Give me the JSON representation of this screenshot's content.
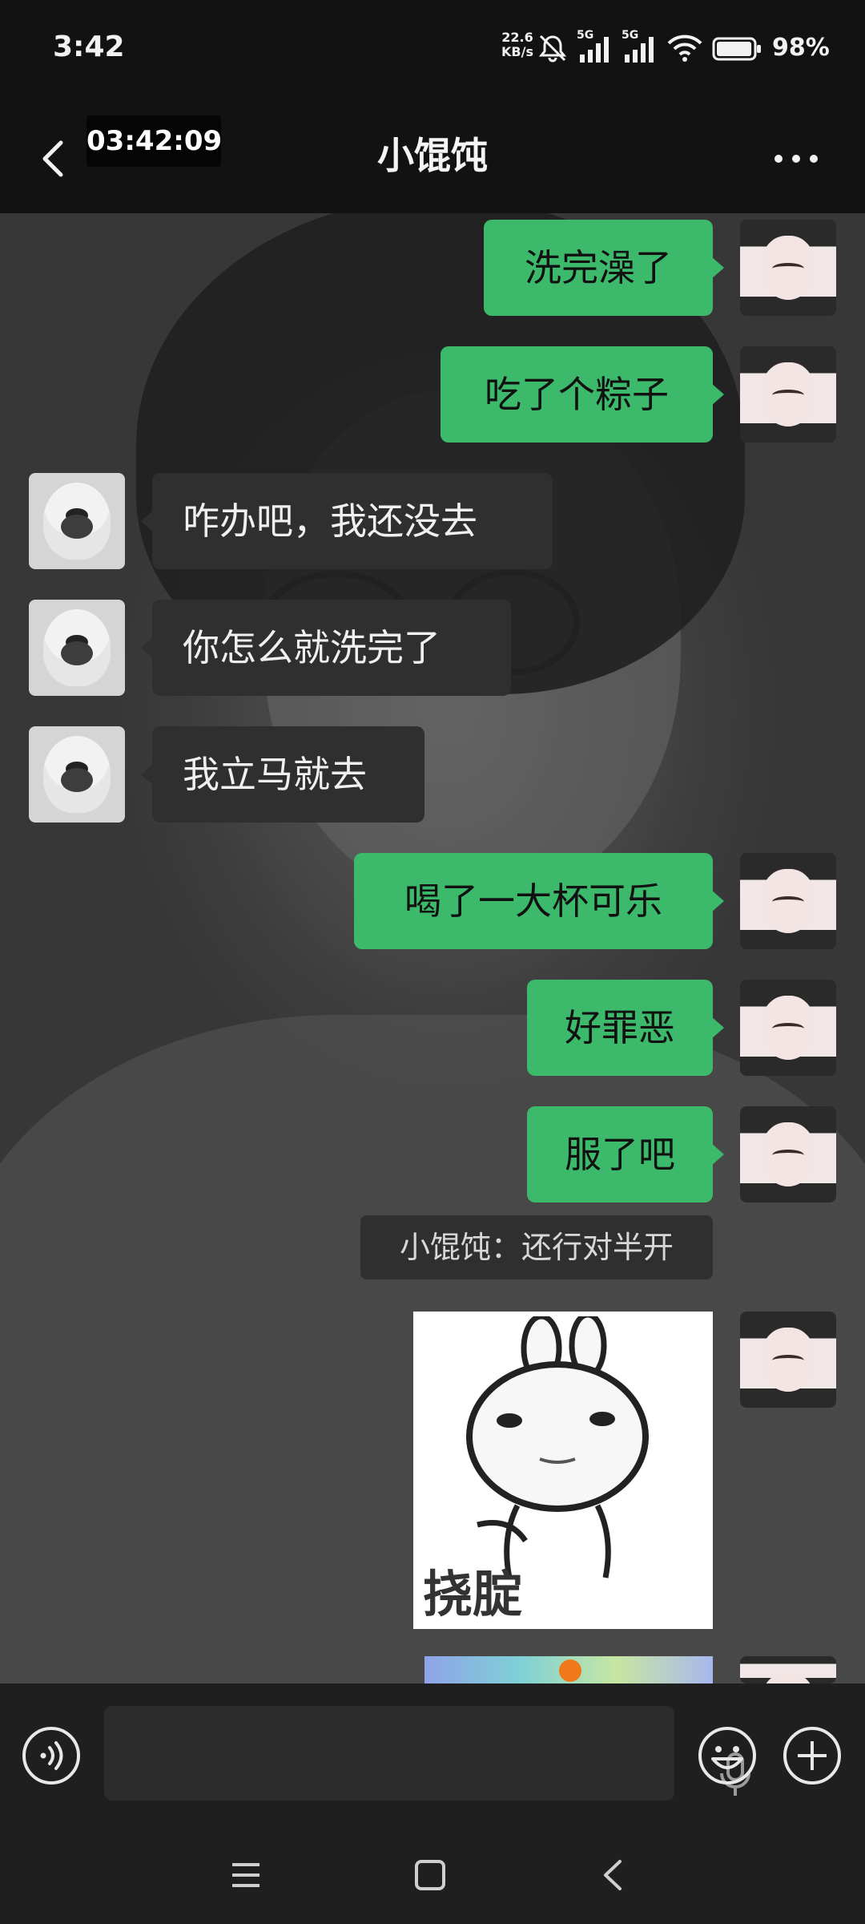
{
  "status_bar": {
    "time": "3:42",
    "net_speed_value": "22.6",
    "net_speed_unit": "KB/s",
    "signal_label_1": "5G",
    "signal_label_2": "5G",
    "battery": "98%",
    "battery_level": 0.98
  },
  "header": {
    "timer": "03:42:09",
    "title": "小馄饨"
  },
  "messages": [
    {
      "side": "me",
      "text": "洗完澡了"
    },
    {
      "side": "me",
      "text": "吃了个粽子"
    },
    {
      "side": "other",
      "text": "咋办吧，我还没去"
    },
    {
      "side": "other",
      "text": "你怎么就洗完了"
    },
    {
      "side": "other",
      "text": "我立马就去"
    },
    {
      "side": "me",
      "text": "喝了一大杯可乐"
    },
    {
      "side": "me",
      "text": "好罪恶"
    },
    {
      "side": "me",
      "text": "服了吧"
    }
  ],
  "system_notice": "小馄饨：还行对半开",
  "sticker": {
    "caption": "挠腚"
  },
  "icons": {
    "back": "chevron-left-icon",
    "more": "more-horizontal-icon",
    "voice": "voice-icon",
    "mic": "microphone-icon",
    "emoji": "emoji-icon",
    "plus": "plus-icon",
    "nav_menu": "menu-icon",
    "nav_home": "home-icon",
    "nav_back": "back-icon"
  },
  "colors": {
    "sent_bubble": "#3cb96b",
    "received_bubble": "#2f2f2f",
    "bar_background": "#1f1f1f"
  }
}
